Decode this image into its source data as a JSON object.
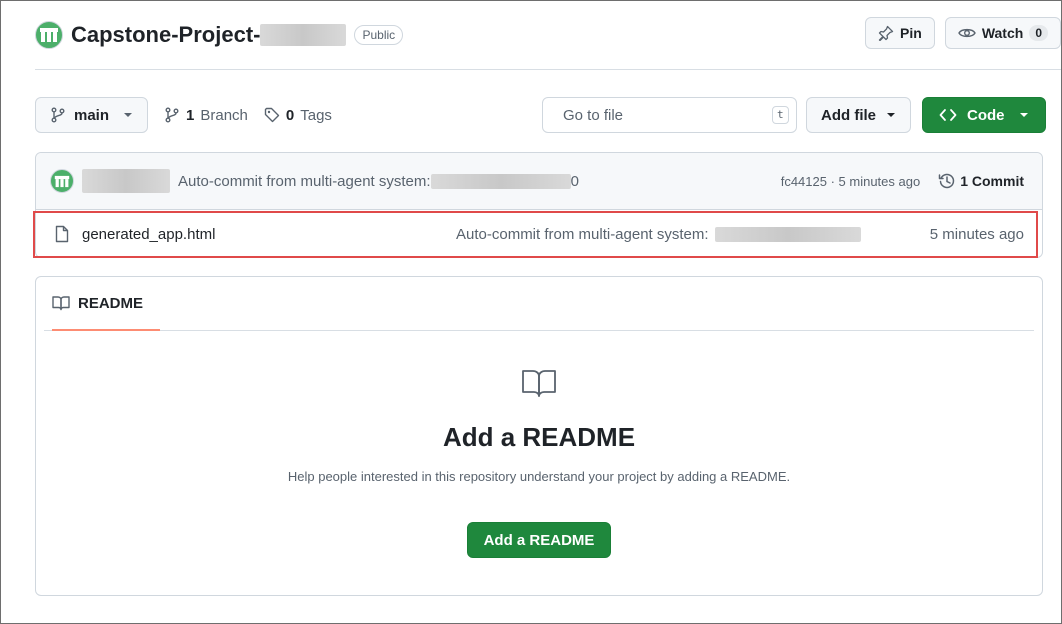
{
  "repo": {
    "name": "Capstone-Project-",
    "visibility": "Public"
  },
  "header_actions": {
    "pin_label": "Pin",
    "watch_label": "Watch",
    "watch_count": "0"
  },
  "toolbar": {
    "branch_label": "main",
    "branches_count": "1",
    "branches_label": "Branch",
    "tags_count": "0",
    "tags_label": "Tags",
    "search_placeholder": "Go to file",
    "search_shortcut": "t",
    "add_file_label": "Add file",
    "code_label": "Code"
  },
  "latest_commit": {
    "message": "Auto-commit from multi-agent system:",
    "message_tail": "0",
    "hash_time": "fc44125 · 5 minutes ago",
    "commit_count_label": "1 Commit"
  },
  "files": [
    {
      "name": "generated_app.html",
      "commit_message": "Auto-commit from multi-agent system:",
      "time": "5 minutes ago"
    }
  ],
  "readme": {
    "tab_label": "README",
    "title": "Add a README",
    "description": "Help people interested in this repository understand your project by adding a README.",
    "button_label": "Add a README"
  },
  "colors": {
    "accent_green": "#1f883d",
    "highlight_red": "#e04a4a",
    "tab_underline": "#fd8c73"
  },
  "icons": [
    "pin-icon",
    "eye-icon",
    "branch-icon",
    "tag-icon",
    "search-icon",
    "code-icon",
    "history-icon",
    "file-icon",
    "book-icon",
    "caret-down-icon"
  ]
}
